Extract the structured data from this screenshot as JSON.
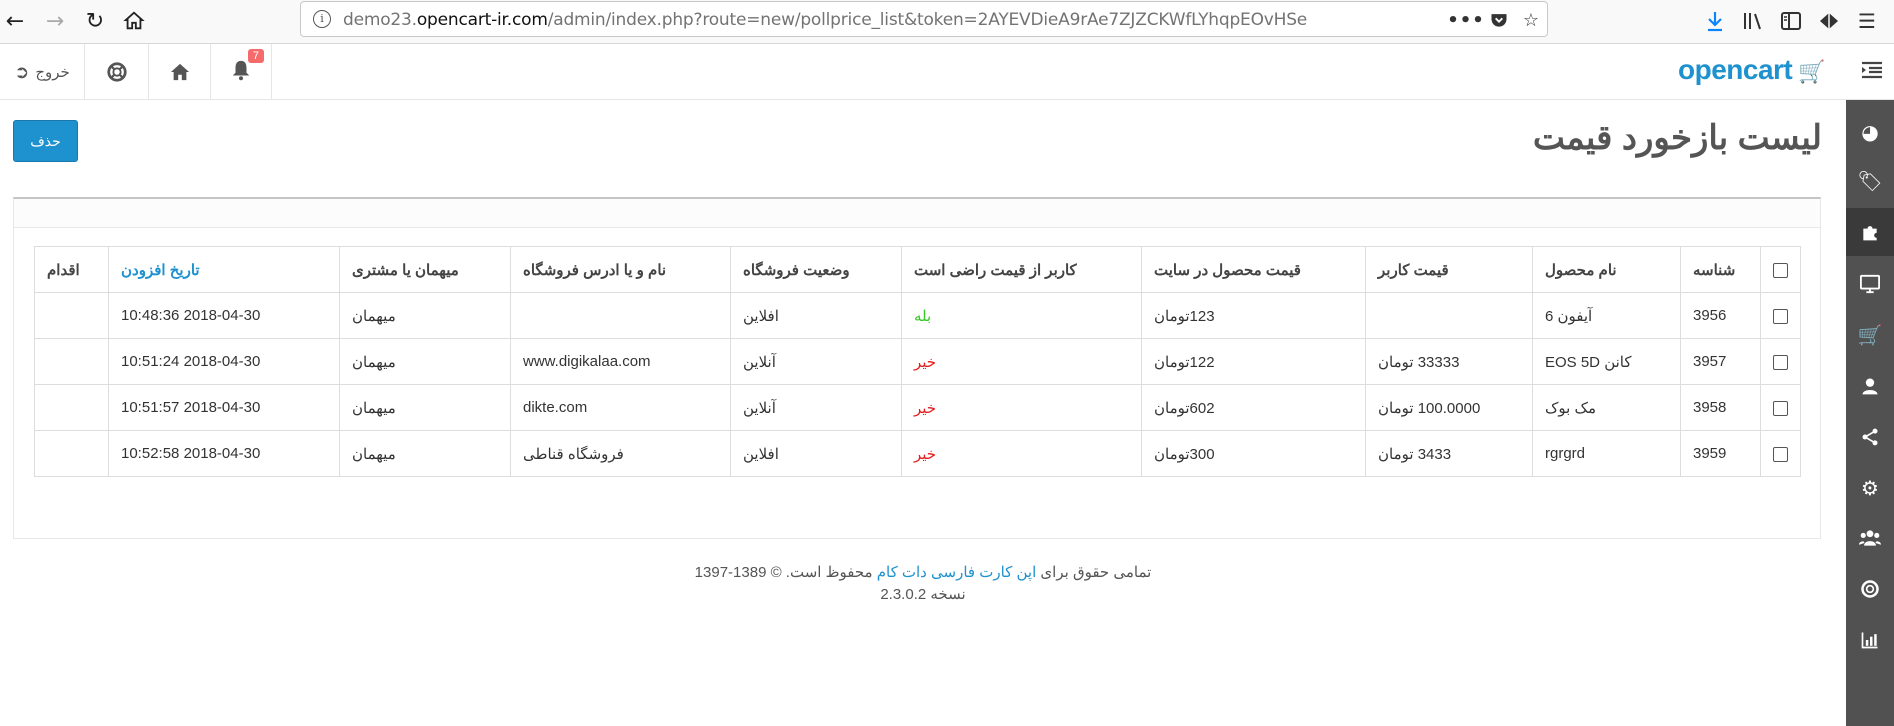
{
  "browser": {
    "url_prefix": "demo23.",
    "url_host": "opencart-ir.com",
    "url_suffix": "/admin/index.php?route=new/pollprice_list&token=2AYEVDieA9rAe7ZJZCKWfLYhqpEOvHSe"
  },
  "header": {
    "logo_text": "opencart",
    "logout_label": "خروج",
    "notification_count": "7"
  },
  "page": {
    "title": "لیست بازخورد قیمت",
    "delete_label": "حذف"
  },
  "table": {
    "headers": {
      "id": "شناسه",
      "product_name": "نام محصول",
      "user_price": "قیمت کاربر",
      "site_price": "قیمت محصول در سایت",
      "satisfied": "کاربر از قیمت راضی است",
      "store_status": "وضعیت فروشگاه",
      "store_name": "نام و یا ادرس فروشگاه",
      "customer_type": "میهمان یا مشتری",
      "date_added": "تاریخ افزودن",
      "action": "اقدام"
    },
    "rows": [
      {
        "id": "3956",
        "product_name": "آیفون 6",
        "user_price": "",
        "site_price": "123تومان",
        "satisfied": "بله",
        "store_status": "افلاین",
        "store_name": "",
        "customer_type": "میهمان",
        "date_added": "2018-04-30 10:48:36"
      },
      {
        "id": "3957",
        "product_name": "کانن EOS 5D",
        "user_price": "33333 تومان",
        "site_price": "122تومان",
        "satisfied": "خیر",
        "store_status": "آنلاین",
        "store_name": "www.digikalaa.com",
        "customer_type": "میهمان",
        "date_added": "2018-04-30 10:51:24"
      },
      {
        "id": "3958",
        "product_name": "مک بوک",
        "user_price": "100.0000 تومان",
        "site_price": "602تومان",
        "satisfied": "خیر",
        "store_status": "آنلاین",
        "store_name": "dikte.com",
        "customer_type": "میهمان",
        "date_added": "2018-04-30 10:51:57"
      },
      {
        "id": "3959",
        "product_name": "rgrgrd",
        "user_price": "3433 تومان",
        "site_price": "300تومان",
        "satisfied": "خیر",
        "store_status": "افلاین",
        "store_name": "فروشگاه قناطی",
        "customer_type": "میهمان",
        "date_added": "2018-04-30 10:52:58"
      }
    ]
  },
  "footer": {
    "line1_prefix": "تمامی حقوق برای",
    "line1_link": "اپن کارت فارسی دات کام",
    "line1_suffix": "محفوظ است. © 1389-1397",
    "line2": "نسخه 2.3.0.2"
  },
  "icons": {
    "back": "arrow-left-icon",
    "forward": "arrow-right-icon",
    "reload": "reload-icon",
    "home": "home-icon",
    "bell": "bell-icon",
    "lifebuoy": "lifebuoy-icon",
    "logout": "sign-out-icon"
  }
}
